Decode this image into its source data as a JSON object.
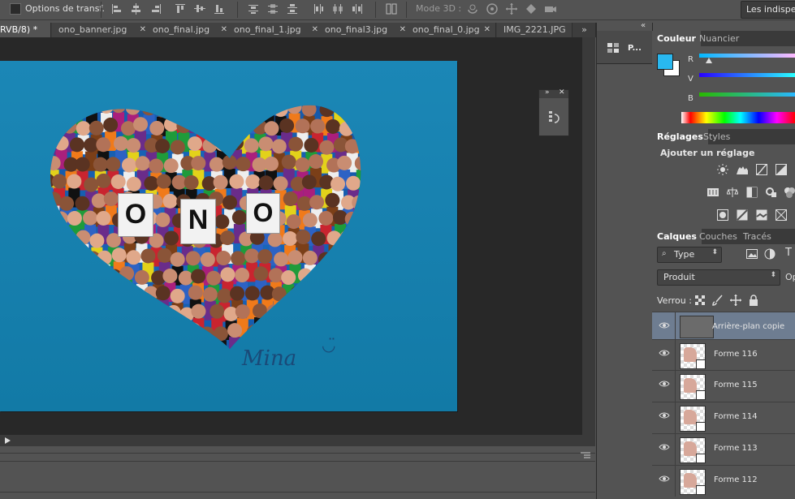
{
  "options_bar": {
    "transform_checkbox_label": "Options de transf.",
    "mode3d_label": "Mode 3D :",
    "workspace_label": "Les indispensables"
  },
  "doc_tabs": [
    {
      "label": "RVB/8) *",
      "active": true
    },
    {
      "label": "ono_banner.jpg",
      "active": false
    },
    {
      "label": "ono_final.jpg",
      "active": false
    },
    {
      "label": "ono_final_1.jpg",
      "active": false
    },
    {
      "label": "ono_final3.jpg",
      "active": false
    },
    {
      "label": "ono_final_0.jpg",
      "active": false
    },
    {
      "label": "IMG_2221.JPG",
      "active": false
    }
  ],
  "tabs_overflow": "»",
  "canvas": {
    "letters": [
      "O",
      "N",
      "O"
    ],
    "signature": "Mina"
  },
  "dock": {
    "collapse_arrows": "«",
    "paragraph_label": "P..."
  },
  "color_panel": {
    "tabs": [
      "Couleur",
      "Nuancier"
    ],
    "channels": [
      "R",
      "V",
      "B"
    ],
    "foreground": "#29b8f0",
    "background": "#ffffff"
  },
  "adjust_panel": {
    "tabs": [
      "Réglages",
      "Styles"
    ],
    "heading": "Ajouter un réglage"
  },
  "layers_panel": {
    "tabs": [
      "Calques",
      "Couches",
      "Tracés"
    ],
    "filter_label": "Type",
    "blend_mode": "Produit",
    "opacity_label": "Op",
    "lock_label": "Verrou :",
    "layers": [
      {
        "name": "Arrière-plan copie",
        "selected": true
      },
      {
        "name": "Forme 116",
        "selected": false
      },
      {
        "name": "Forme 115",
        "selected": false
      },
      {
        "name": "Forme 114",
        "selected": false
      },
      {
        "name": "Forme 113",
        "selected": false
      },
      {
        "name": "Forme 112",
        "selected": false
      }
    ]
  }
}
